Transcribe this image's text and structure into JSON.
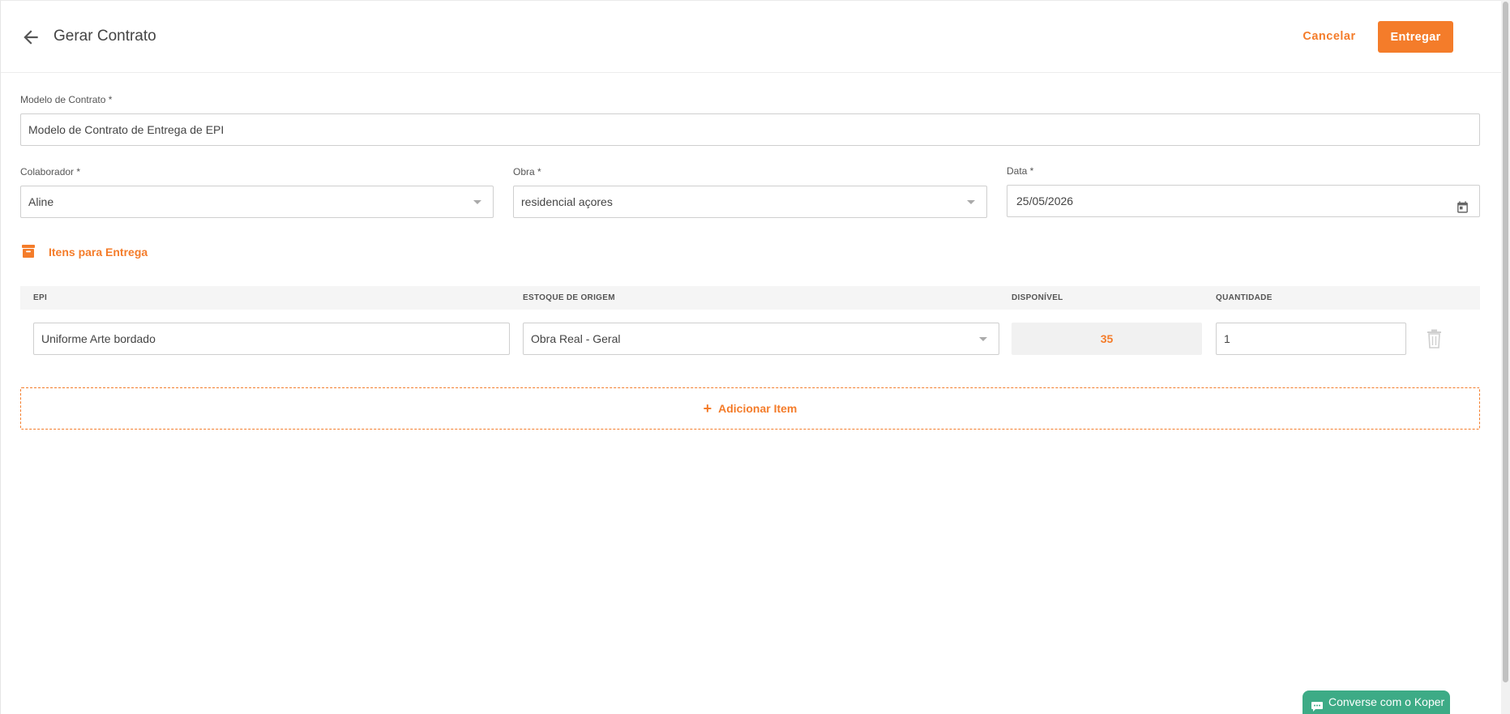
{
  "header": {
    "title": "Gerar Contrato",
    "cancel_label": "Cancelar",
    "deliver_label": "Entregar"
  },
  "form": {
    "contract_model": {
      "label": "Modelo de Contrato *",
      "value": "Modelo de Contrato de Entrega de EPI"
    },
    "employee": {
      "label": "Colaborador *",
      "value": "Aline"
    },
    "site": {
      "label": "Obra *",
      "value": "residencial açores"
    },
    "date": {
      "label": "Data *",
      "value": "25/05/2026"
    }
  },
  "items_section": {
    "title": "Itens para Entrega",
    "columns": {
      "epi": "EPI",
      "origin_stock": "ESTOQUE DE ORIGEM",
      "available": "DISPONÍVEL",
      "quantity": "QUANTIDADE"
    },
    "rows": [
      {
        "epi": "Uniforme Arte bordado",
        "origin_stock": "Obra Real - Geral",
        "available": "35",
        "quantity": "1"
      }
    ],
    "add_item_label": "Adicionar Item"
  },
  "chat": {
    "label": "Converse com o Koper"
  },
  "colors": {
    "accent": "#f47c2a",
    "chat": "#3dab86"
  },
  "icons": {
    "back": "arrow-left-icon",
    "calendar": "calendar-icon",
    "section": "archive-box-icon",
    "delete": "trash-icon",
    "add": "plus-icon",
    "chat": "chat-bubble-icon"
  }
}
